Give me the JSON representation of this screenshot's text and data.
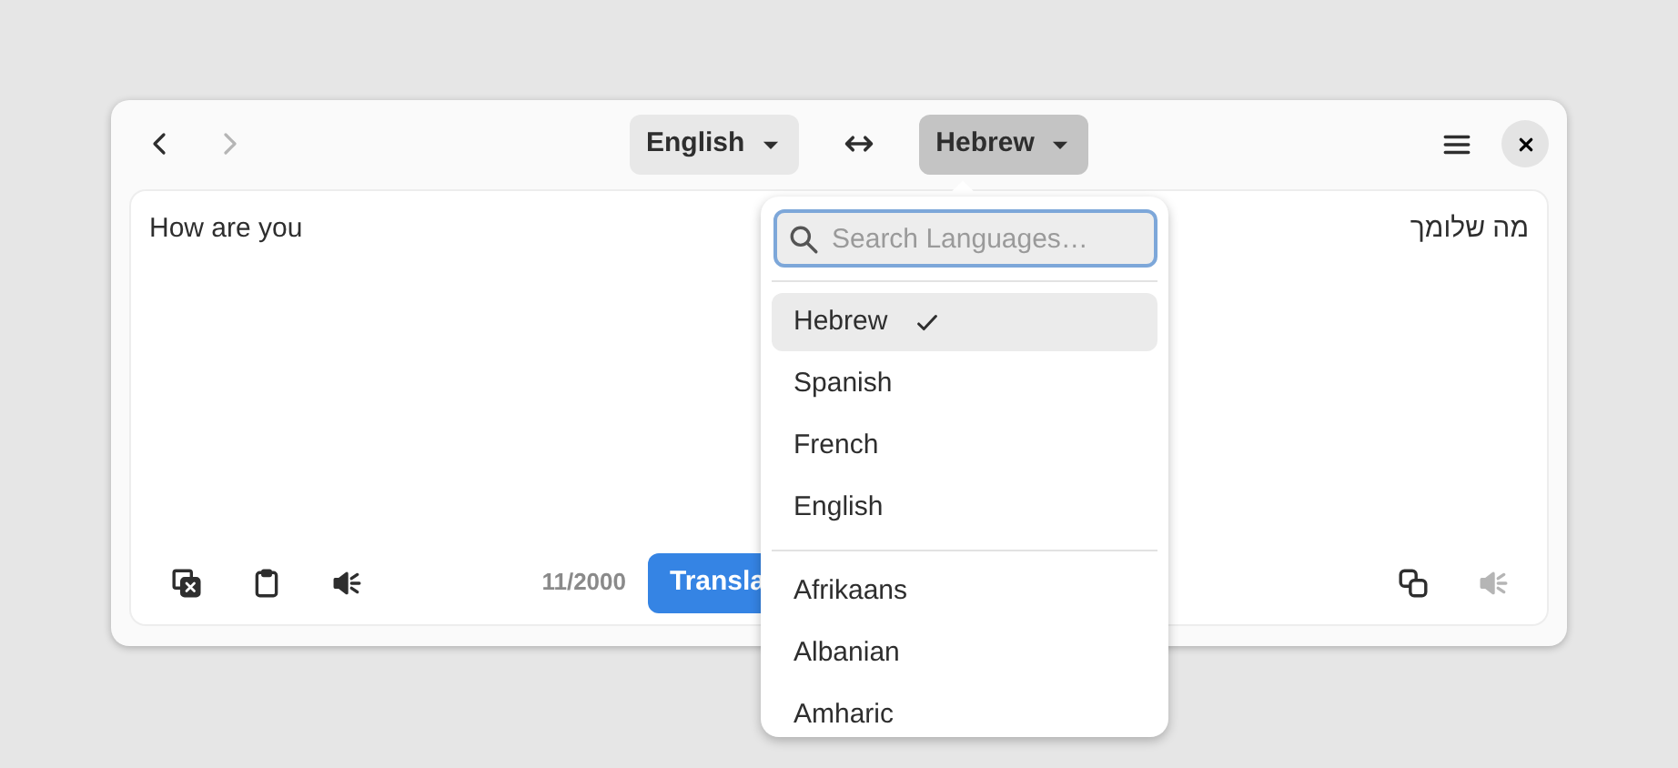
{
  "header": {
    "nav": [
      {
        "kind": "back",
        "disabled": false
      },
      {
        "kind": "forward",
        "disabled": true
      }
    ],
    "source_language": {
      "label": "English",
      "open": false
    },
    "target_language": {
      "label": "Hebrew",
      "open": true
    }
  },
  "source": {
    "text": "How are you",
    "char_count": "11/2000",
    "translate_button": "Transla"
  },
  "target": {
    "text": "מה שלומך",
    "speak_disabled": true
  },
  "language_popover": {
    "placeholder": "Search Languages…",
    "groups": [
      [
        {
          "label": "Hebrew",
          "selected": true
        },
        {
          "label": "Spanish",
          "selected": false
        },
        {
          "label": "French",
          "selected": false
        },
        {
          "label": "English",
          "selected": false
        }
      ],
      [
        {
          "label": "Afrikaans",
          "selected": false
        },
        {
          "label": "Albanian",
          "selected": false
        },
        {
          "label": "Amharic",
          "selected": false
        }
      ]
    ]
  }
}
